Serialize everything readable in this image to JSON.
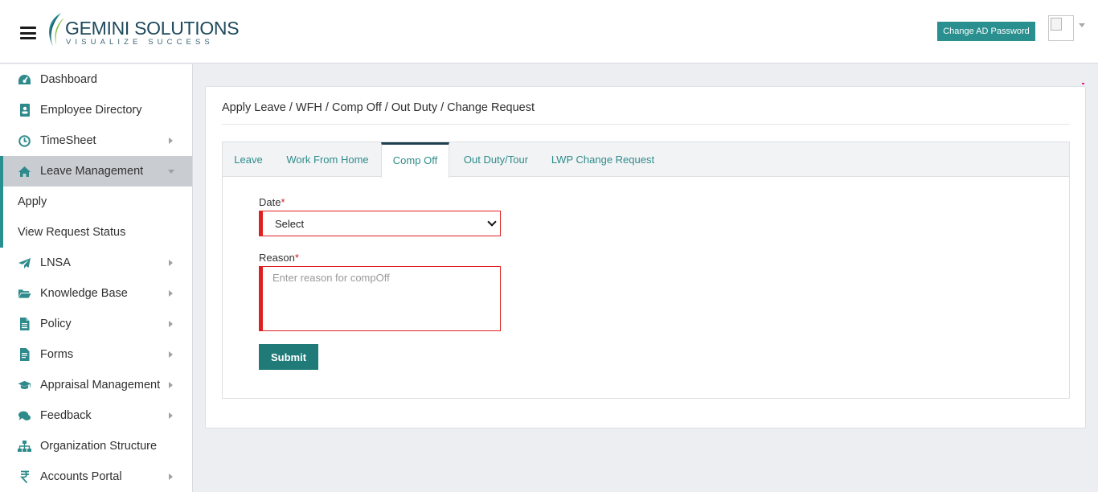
{
  "header": {
    "logo_main": "GEMINI SOLUTIONS",
    "logo_tagline": "VISUALIZE SUCCESS",
    "change_password_label": "Change AD Password",
    "menu_icon": "hamburger-menu-icon",
    "avatar_icon": "broken-image-icon"
  },
  "sidebar": {
    "items": [
      {
        "label": "Dashboard",
        "icon": "dashboard-gauge-icon",
        "has_arrow": false
      },
      {
        "label": "Employee Directory",
        "icon": "contact-book-icon",
        "has_arrow": false
      },
      {
        "label": "TimeSheet",
        "icon": "clock-icon",
        "has_arrow": true
      },
      {
        "label": "Leave Management",
        "icon": "home-icon",
        "has_arrow": true,
        "expanded": true
      },
      {
        "label": "LNSA",
        "icon": "paper-plane-icon",
        "has_arrow": true
      },
      {
        "label": "Knowledge Base",
        "icon": "folder-open-icon",
        "has_arrow": true
      },
      {
        "label": "Policy",
        "icon": "document-icon",
        "has_arrow": true
      },
      {
        "label": "Forms",
        "icon": "file-text-icon",
        "has_arrow": true
      },
      {
        "label": "Appraisal Management",
        "icon": "graduation-cap-icon",
        "has_arrow": true
      },
      {
        "label": "Feedback",
        "icon": "chat-bubbles-icon",
        "has_arrow": true
      },
      {
        "label": "Organization Structure",
        "icon": "org-chart-icon",
        "has_arrow": false
      },
      {
        "label": "Accounts Portal",
        "icon": "rupee-icon",
        "has_arrow": true
      }
    ],
    "sub_items": [
      {
        "label": "Apply"
      },
      {
        "label": "View Request Status"
      }
    ]
  },
  "main": {
    "title": "Apply Leave / WFH / Comp Off / Out Duty / Change Request",
    "tabs": [
      {
        "label": "Leave",
        "active": false
      },
      {
        "label": "Work From Home",
        "active": false
      },
      {
        "label": "Comp Off",
        "active": true
      },
      {
        "label": "Out Duty/Tour",
        "active": false
      },
      {
        "label": "LWP Change Request",
        "active": false
      }
    ],
    "form": {
      "date_label": "Date",
      "required_mark": "*",
      "date_value": "Select",
      "reason_label": "Reason",
      "reason_placeholder": "Enter reason for compOff",
      "submit_label": "Submit"
    }
  },
  "colors": {
    "accent": "#2a8f8f",
    "submit": "#1f7a78",
    "error_border": "#e02020",
    "active_tab_top": "#1f3f4f",
    "sidebar_active_bg": "#c9cdd2"
  }
}
